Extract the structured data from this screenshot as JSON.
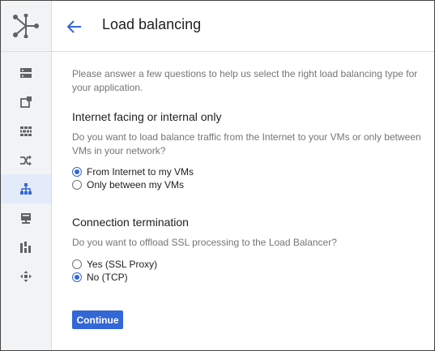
{
  "header": {
    "title": "Load balancing",
    "back_icon": "arrow-back-icon"
  },
  "rail": {
    "logo_icon": "network-services-logo-icon",
    "items": [
      {
        "icon": "server-list-icon",
        "active": false
      },
      {
        "icon": "external-ip-icon",
        "active": false
      },
      {
        "icon": "firewall-icon",
        "active": false
      },
      {
        "icon": "routes-icon",
        "active": false
      },
      {
        "icon": "load-balancing-icon",
        "active": true
      },
      {
        "icon": "vpn-icon",
        "active": false
      },
      {
        "icon": "monitoring-icon",
        "active": false
      },
      {
        "icon": "interconnect-icon",
        "active": false
      }
    ]
  },
  "intro": "Please answer a few questions to help us select the right load balancing type for your application.",
  "sections": [
    {
      "title": "Internet facing or internal only",
      "description": "Do you want to load balance traffic from the Internet to your VMs or only between VMs in your network?",
      "options": [
        {
          "label": "From Internet to my VMs",
          "selected": true
        },
        {
          "label": "Only between my VMs",
          "selected": false
        }
      ]
    },
    {
      "title": "Connection termination",
      "description": "Do you want to offload SSL processing to the Load Balancer?",
      "options": [
        {
          "label": "Yes (SSL Proxy)",
          "selected": false
        },
        {
          "label": "No (TCP)",
          "selected": true
        }
      ]
    }
  ],
  "continue_label": "Continue",
  "colors": {
    "accent": "#3367d6",
    "active_rail_bg": "#e3ebfb",
    "rail_bg": "#f1f3f4",
    "icon": "#5f6368",
    "secondary_text": "#757575"
  }
}
